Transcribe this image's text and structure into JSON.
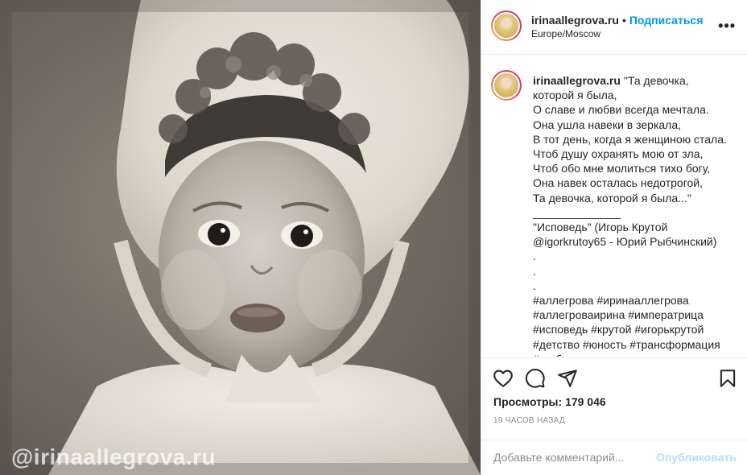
{
  "photo": {
    "watermark": "@irinaallegrova.ru",
    "alt": "baby-portrait"
  },
  "post_header": {
    "username": "irinaallegrova.ru",
    "separator": "•",
    "follow_label": "Подписаться",
    "location": "Europe/Moscow",
    "more_label": "•••"
  },
  "caption": {
    "username": "irinaallegrova.ru",
    "text": "\"Та девочка,\nкоторой я была,\nО славе и любви всегда мечтала.\nОна ушла навеки в зеркала,\nВ тот день, когда я женщиною стала.\nЧтоб душу охранять мою от зла,\nЧтоб обо мне молиться тихо богу,\nОна навек осталась недотрогой,\nТа девочка, которой я была...\"\n______________\n\"Исповедь\" (Игорь Крутой\n@igorkrutoy65 - Юрий Рыбчинский)\n.\n.\n.\n#аллегрова #иринааллегрова\n#аллегроваирина #императрица\n#исповедь #крутой #игорькрутой\n#детство #юность #трансформация\n#глубокоеодиночество"
  },
  "actions": {
    "like_icon": "heart-icon",
    "comment_icon": "comment-icon",
    "share_icon": "paper-plane-icon",
    "save_icon": "bookmark-icon",
    "views_label": "Просмотры:",
    "views_count": "179 046",
    "timestamp": "19 часов назад"
  },
  "comment": {
    "placeholder": "Добавьте комментарий...",
    "publish_label": "Опубликовать",
    "publish_color": "#b2dffc"
  },
  "colors": {
    "accent": "#0095f6",
    "text": "#262626",
    "muted": "#8e8e8e",
    "border": "#efefef"
  }
}
